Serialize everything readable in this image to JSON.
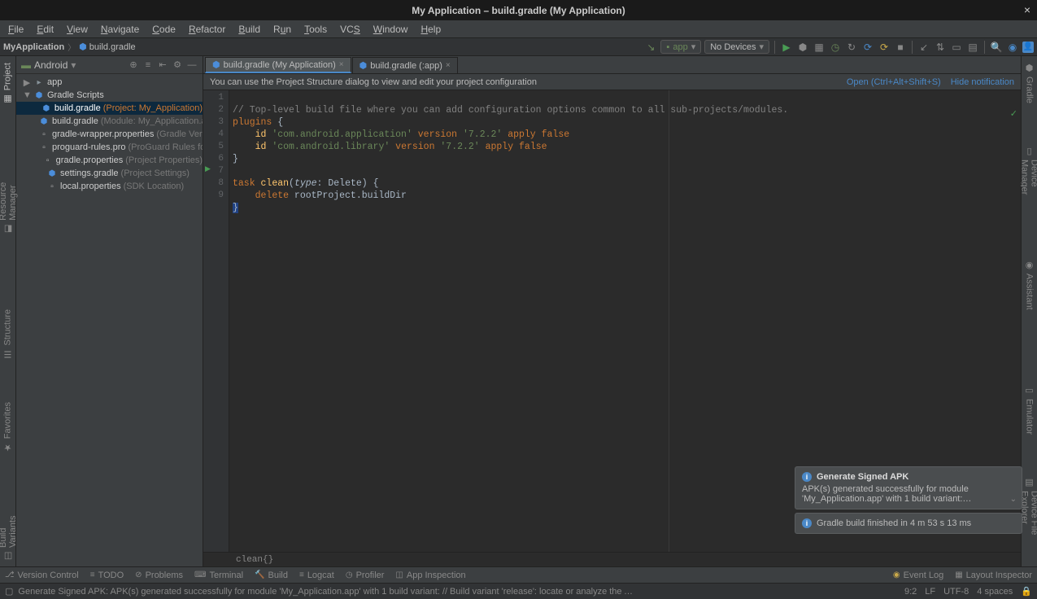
{
  "titlebar": {
    "text": "My Application – build.gradle (My Application)"
  },
  "menubar": {
    "items": [
      "File",
      "Edit",
      "View",
      "Navigate",
      "Code",
      "Refactor",
      "Build",
      "Run",
      "Tools",
      "VCS",
      "Window",
      "Help"
    ]
  },
  "breadcrumb": {
    "project": "MyApplication",
    "file_icon": "gradle",
    "file": "build.gradle"
  },
  "nav": {
    "run_config": "app",
    "device": "No Devices"
  },
  "left_tabs": [
    "Project",
    "Resource Manager",
    "Structure",
    "Favorites",
    "Build Variants"
  ],
  "right_tabs": [
    "Gradle",
    "Device Manager",
    "Assistant",
    "Emulator",
    "Device File Explorer"
  ],
  "project_panel": {
    "selector": "Android",
    "tree": [
      {
        "indent": 0,
        "chevron": "▶",
        "icon": "folder",
        "label": "app",
        "ctx": ""
      },
      {
        "indent": 0,
        "chevron": "▼",
        "icon": "gradle",
        "label": "Gradle Scripts",
        "ctx": ""
      },
      {
        "indent": 1,
        "chevron": "",
        "icon": "gradle",
        "label": "build.gradle ",
        "ctx": "(Project: My_Application)",
        "selected": true
      },
      {
        "indent": 1,
        "chevron": "",
        "icon": "gradle",
        "label": "build.gradle ",
        "ctx": "(Module: My_Application.app)"
      },
      {
        "indent": 1,
        "chevron": "",
        "icon": "prop",
        "label": "gradle-wrapper.properties ",
        "ctx": "(Gradle Version)"
      },
      {
        "indent": 1,
        "chevron": "",
        "icon": "prop",
        "label": "proguard-rules.pro ",
        "ctx": "(ProGuard Rules for My_…"
      },
      {
        "indent": 1,
        "chevron": "",
        "icon": "prop",
        "label": "gradle.properties ",
        "ctx": "(Project Properties)"
      },
      {
        "indent": 1,
        "chevron": "",
        "icon": "gradle",
        "label": "settings.gradle ",
        "ctx": "(Project Settings)"
      },
      {
        "indent": 1,
        "chevron": "",
        "icon": "prop",
        "label": "local.properties ",
        "ctx": "(SDK Location)"
      }
    ]
  },
  "editor_tabs": [
    {
      "label": "build.gradle (My Application)",
      "active": true
    },
    {
      "label": "build.gradle (:app)",
      "active": false
    }
  ],
  "notif": {
    "text": "You can use the Project Structure dialog to view and edit your project configuration",
    "open": "Open (Ctrl+Alt+Shift+S)",
    "hide": "Hide notification"
  },
  "code": {
    "line1_comment": "// Top-level build file where you can add configuration options common to all sub-projects/modules.",
    "plugins": "plugins ",
    "id": "id ",
    "app_id": "'com.android.application'",
    "version": " version ",
    "v": "'7.2.2'",
    "apply": " apply ",
    "false": "false",
    "lib_id": "'com.android.library'",
    "task": "task ",
    "clean": "clean",
    "tparen": "(",
    "type": "type",
    "colon": ": ",
    "Delete": "Delete",
    "tparen2": ") ",
    "delete": "delete ",
    "root": "rootProject",
    "dot": ".",
    "buildDir": "buildDir",
    "brace_o": "{",
    "brace_c": "}"
  },
  "code_context": "clean{}",
  "bottom_tabs": {
    "left": [
      "Version Control",
      "TODO",
      "Problems",
      "Terminal",
      "Build",
      "Logcat",
      "Profiler",
      "App Inspection"
    ],
    "right": [
      "Event Log",
      "Layout Inspector"
    ]
  },
  "statusbar": {
    "msg": "Generate Signed APK: APK(s) generated successfully for module 'My_Application.app' with 1 build variant: // Build variant 'release': locate or analyze the APK. (moments ago)",
    "pos": "9:2",
    "le": "LF",
    "enc": "UTF-8",
    "indent": "4 spaces"
  },
  "toasts": {
    "t1_title": "Generate Signed APK",
    "t1_body": "APK(s) generated successfully for module 'My_Application.app' with 1 build variant:…",
    "t2": "Gradle build finished in 4 m 53 s 13 ms"
  }
}
